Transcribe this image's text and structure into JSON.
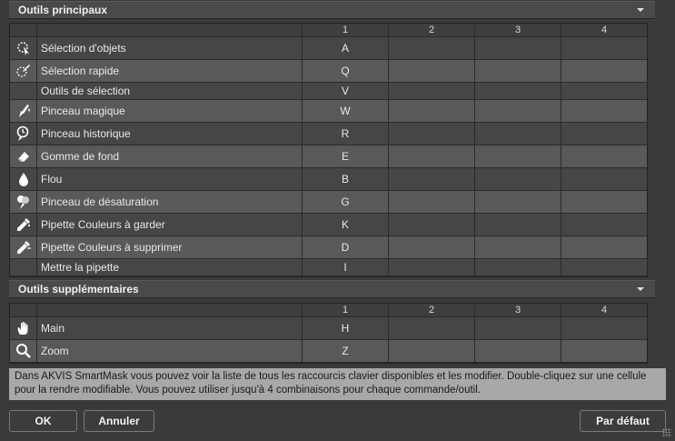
{
  "sections": [
    {
      "title": "Outils principaux",
      "columns": [
        "1",
        "2",
        "3",
        "4"
      ],
      "rows": [
        {
          "icon": "object-selection-icon",
          "name": "Sélection d'objets",
          "keys": [
            "A",
            "",
            "",
            ""
          ]
        },
        {
          "icon": "quick-selection-icon",
          "name": "Sélection rapide",
          "keys": [
            "Q",
            "",
            "",
            ""
          ]
        },
        {
          "icon": "",
          "name": "Outils de sélection",
          "keys": [
            "V",
            "",
            "",
            ""
          ]
        },
        {
          "icon": "magic-brush-icon",
          "name": "Pinceau magique",
          "keys": [
            "W",
            "",
            "",
            ""
          ]
        },
        {
          "icon": "history-brush-icon",
          "name": "Pinceau historique",
          "keys": [
            "R",
            "",
            "",
            ""
          ]
        },
        {
          "icon": "background-eraser-icon",
          "name": "Gomme de fond",
          "keys": [
            "E",
            "",
            "",
            ""
          ]
        },
        {
          "icon": "blur-drop-icon",
          "name": "Flou",
          "keys": [
            "B",
            "",
            "",
            ""
          ]
        },
        {
          "icon": "desaturate-brush-icon",
          "name": "Pinceau de désaturation",
          "keys": [
            "G",
            "",
            "",
            ""
          ]
        },
        {
          "icon": "eyedropper-keep-icon",
          "name": "Pipette Couleurs à garder",
          "keys": [
            "K",
            "",
            "",
            ""
          ]
        },
        {
          "icon": "eyedropper-remove-icon",
          "name": "Pipette Couleurs à supprimer",
          "keys": [
            "D",
            "",
            "",
            ""
          ]
        },
        {
          "icon": "",
          "name": "Mettre la pipette",
          "keys": [
            "I",
            "",
            "",
            ""
          ]
        }
      ]
    },
    {
      "title": "Outils supplémentaires",
      "columns": [
        "1",
        "2",
        "3",
        "4"
      ],
      "rows": [
        {
          "icon": "hand-icon",
          "name": "Main",
          "keys": [
            "H",
            "",
            "",
            ""
          ]
        },
        {
          "icon": "zoom-icon",
          "name": "Zoom",
          "keys": [
            "Z",
            "",
            "",
            ""
          ]
        }
      ]
    }
  ],
  "info_text": "Dans AKVIS SmartMask vous pouvez voir la liste de tous les raccourcis clavier disponibles et les modifier.  Double-cliquez sur une cellule pour la rendre modifiable. Vous pouvez utiliser jusqu'à 4 combinaisons pour chaque commande/outil.",
  "buttons": {
    "ok": "OK",
    "cancel": "Annuler",
    "default": "Par défaut"
  }
}
